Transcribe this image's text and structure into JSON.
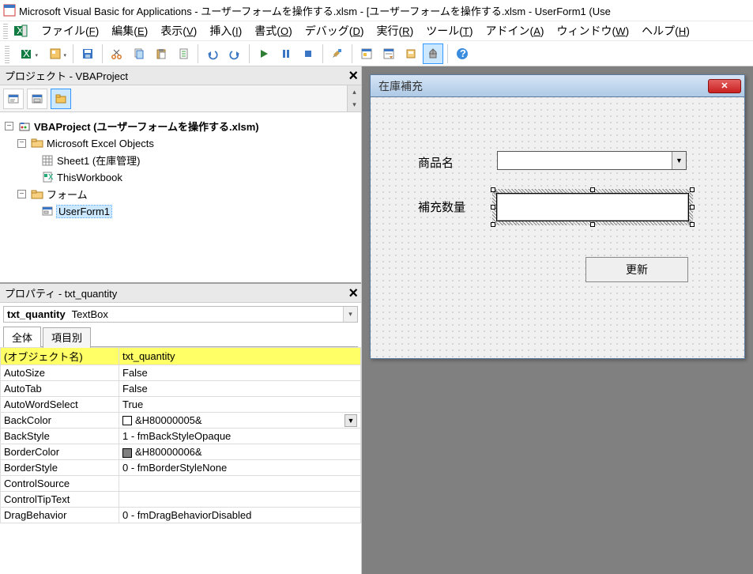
{
  "titlebar": {
    "text": "Microsoft Visual Basic for Applications - ユーザーフォームを操作する.xlsm - [ユーザーフォームを操作する.xlsm - UserForm1 (Use"
  },
  "menubar": {
    "items": [
      {
        "label": "ファイル",
        "key": "F"
      },
      {
        "label": "編集",
        "key": "E"
      },
      {
        "label": "表示",
        "key": "V"
      },
      {
        "label": "挿入",
        "key": "I"
      },
      {
        "label": "書式",
        "key": "O"
      },
      {
        "label": "デバッグ",
        "key": "D"
      },
      {
        "label": "実行",
        "key": "R"
      },
      {
        "label": "ツール",
        "key": "T"
      },
      {
        "label": "アドイン",
        "key": "A"
      },
      {
        "label": "ウィンドウ",
        "key": "W"
      },
      {
        "label": "ヘルプ",
        "key": "H"
      }
    ]
  },
  "project_panel": {
    "title": "プロジェクト - VBAProject",
    "root": "VBAProject (ユーザーフォームを操作する.xlsm)",
    "folder_excel": "Microsoft Excel Objects",
    "sheet1": "Sheet1 (在庫管理)",
    "thiswb": "ThisWorkbook",
    "folder_forms": "フォーム",
    "userform1": "UserForm1"
  },
  "props_panel": {
    "title": "プロパティ - txt_quantity",
    "combo_left": "txt_quantity",
    "combo_right": "TextBox",
    "tab_all": "全体",
    "tab_cat": "項目別",
    "rows": [
      {
        "name": "(オブジェクト名)",
        "value": "txt_quantity",
        "hl": true
      },
      {
        "name": "AutoSize",
        "value": "False"
      },
      {
        "name": "AutoTab",
        "value": "False"
      },
      {
        "name": "AutoWordSelect",
        "value": "True"
      },
      {
        "name": "BackColor",
        "value": "&H80000005&",
        "swatch": "#ffffff",
        "dd": true
      },
      {
        "name": "BackStyle",
        "value": "1 - fmBackStyleOpaque"
      },
      {
        "name": "BorderColor",
        "value": "&H80000006&",
        "swatch": "#808080"
      },
      {
        "name": "BorderStyle",
        "value": "0 - fmBorderStyleNone"
      },
      {
        "name": "ControlSource",
        "value": ""
      },
      {
        "name": "ControlTipText",
        "value": ""
      },
      {
        "name": "DragBehavior",
        "value": "0 - fmDragBehaviorDisabled"
      }
    ]
  },
  "userform": {
    "title": "在庫補充",
    "label1": "商品名",
    "label2": "補充数量",
    "button": "更新"
  }
}
